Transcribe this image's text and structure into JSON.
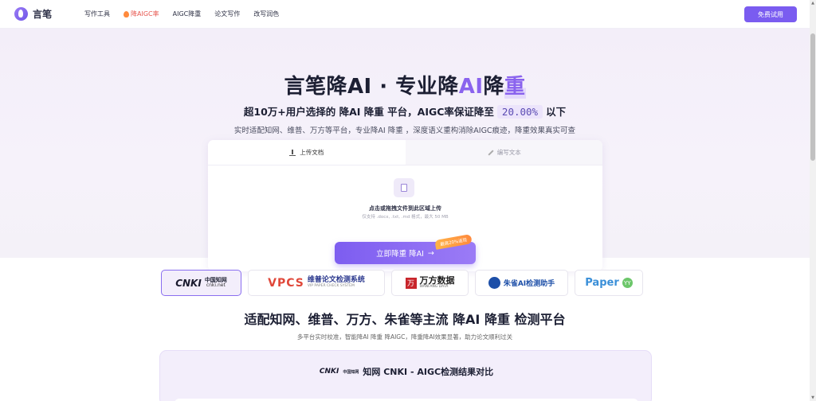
{
  "header": {
    "logo_text": "言笔",
    "nav": [
      {
        "label": "写作工具"
      },
      {
        "label": "降AIGC率",
        "hot": true
      },
      {
        "label": "AIGC降重"
      },
      {
        "label": "论文写作"
      },
      {
        "label": "改写润色"
      }
    ],
    "trial_label": "免费试用"
  },
  "hero": {
    "title_part1": "言笔降AI · 专业降",
    "title_ai": "AI",
    "title_jiang": "降",
    "title_zhong": "重",
    "sub_part1": "超10万+用户选择的 降AI 降重 平台，AIGC率保证降至",
    "sub_rate": "20.00%",
    "sub_part2": "以下",
    "desc": "实时适配知网、维普、万方等平台，专业降AI 降重 ，深度语义重构消除AIGC痕迹，降重效果真实可查"
  },
  "upload": {
    "tab_upload": "上传文档",
    "tab_write": "编写文本",
    "drop_title": "点击或拖拽文件到此区域上传",
    "drop_hint": "仅支持 .docx, .txt, .md 格式，最大 50 MB",
    "submit_label": "立即降重 降AI",
    "submit_arrow": "→",
    "promo": "最高20%返现"
  },
  "platforms": {
    "cnki": "CNKI",
    "cnki_cn": "中国知网",
    "cnki_sub": "cnki.net",
    "vpcs": "VPCS",
    "vpcs_cn": "维普论文检测系统",
    "vpcs_en": "VIP PAPER CHECK SYSTEM",
    "wf_box": "万",
    "wf_text": "万方数据",
    "wf_sub": "WANFANG DATA",
    "zq_text": "朱雀AI检测助手",
    "paper": "Paper",
    "paper_yy": "YY"
  },
  "section": {
    "title": "适配知网、维普、万方、朱雀等主流 降AI 降重 检测平台",
    "desc": "多平台实时校准，智能降AI 降重 降AIGC，降重降AI效果显著，助力论文顺利过关"
  },
  "compare": {
    "cnki": "CNKI",
    "cnki_cn": "中国知网",
    "title": "知网 CNKI - AIGC检测结果对比"
  }
}
